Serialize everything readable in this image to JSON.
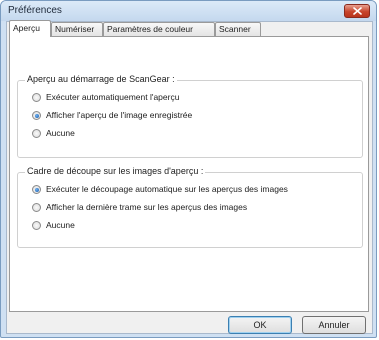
{
  "window": {
    "title": "Préférences"
  },
  "tabs": [
    {
      "label": "Aperçu",
      "active": true
    },
    {
      "label": "Numériser",
      "active": false
    },
    {
      "label": "Paramètres de couleur",
      "active": false
    },
    {
      "label": "Scanner",
      "active": false
    }
  ],
  "group1": {
    "title": "Aperçu au démarrage de ScanGear :",
    "options": [
      {
        "label": "Exécuter automatiquement l'aperçu",
        "checked": false
      },
      {
        "label": "Afficher l'aperçu de l'image enregistrée",
        "checked": true
      },
      {
        "label": "Aucune",
        "checked": false
      }
    ]
  },
  "group2": {
    "title": "Cadre de découpe sur les images d'aperçu :",
    "options": [
      {
        "label": "Exécuter le découpage automatique sur les aperçus des images",
        "checked": true
      },
      {
        "label": "Afficher la dernière trame sur les aperçus des images",
        "checked": false
      },
      {
        "label": "Aucune",
        "checked": false
      }
    ]
  },
  "buttons": {
    "ok": "OK",
    "cancel": "Annuler"
  }
}
